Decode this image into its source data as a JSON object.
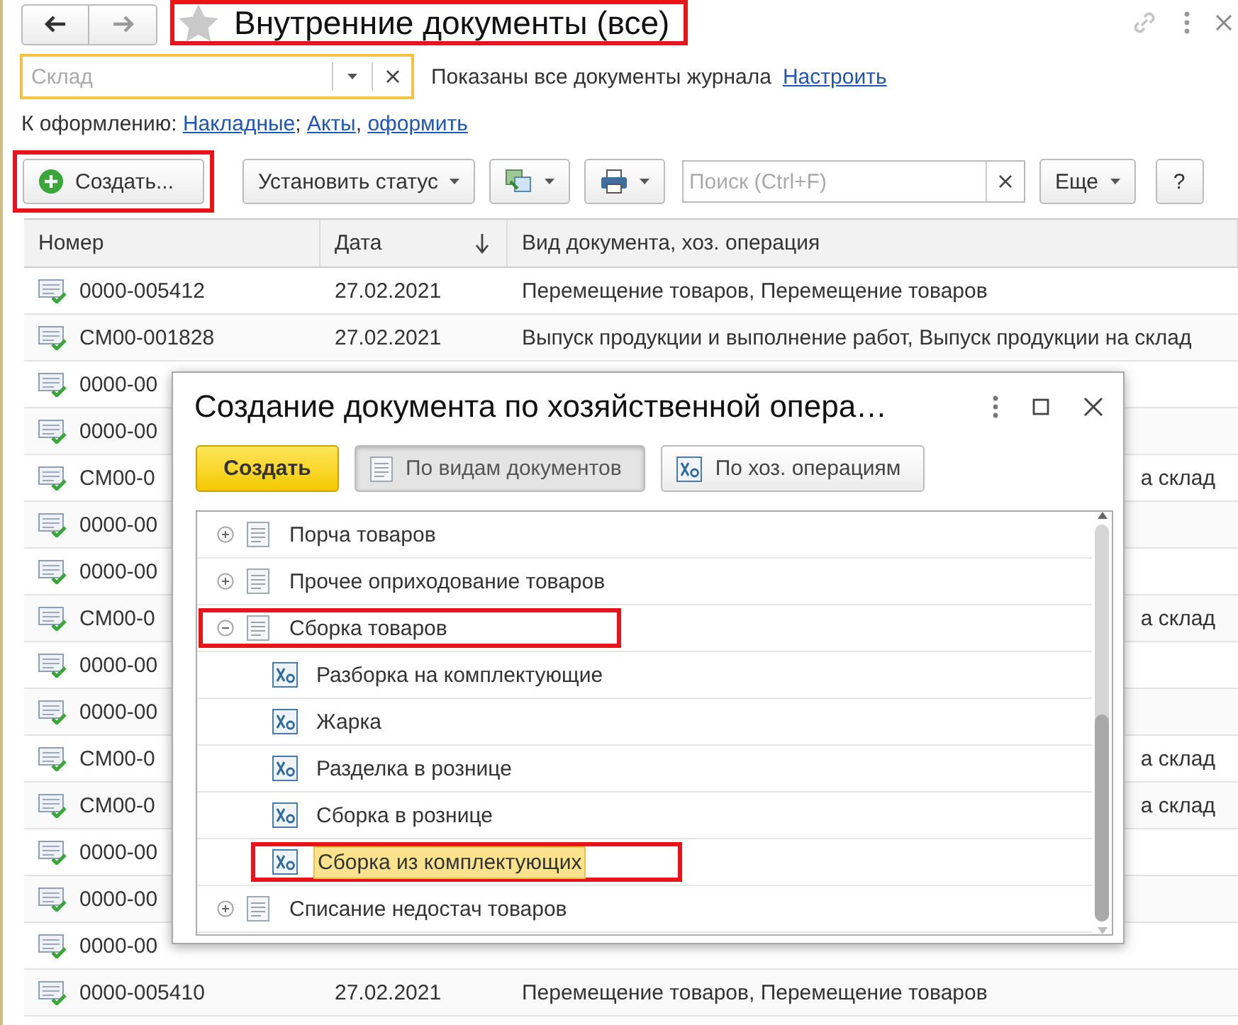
{
  "title": {
    "text": "Внутренние документы (все)",
    "highlighted": true
  },
  "filter": {
    "placeholder": "Склад",
    "status": "Показаны все документы журнала",
    "link": "Настроить"
  },
  "shortcuts": {
    "label": "К оформлению:",
    "links": [
      {
        "text": "Накладные",
        "separator": ";"
      },
      {
        "text": "Акты",
        "separator": ","
      },
      {
        "text": "оформить"
      }
    ]
  },
  "toolbar": {
    "create": {
      "label": "Создать...",
      "highlighted": true
    },
    "status_button": "Установить статус",
    "search": {
      "placeholder": "Поиск (Ctrl+F)"
    },
    "more": "Еще",
    "help": "?"
  },
  "table": {
    "columns": [
      {
        "label": "Номер",
        "sorted": false
      },
      {
        "label": "Дата",
        "sorted": true
      },
      {
        "label": "Вид документа, хоз. операция",
        "sorted": false
      }
    ],
    "rows": [
      {
        "number": "0000-005412",
        "date": "27.02.2021",
        "operation": "Перемещение товаров, Перемещение товаров"
      },
      {
        "number": "CM00-001828",
        "date": "27.02.2021",
        "operation": "Выпуск продукции и выполнение работ, Выпуск продукции на склад"
      },
      {
        "number": "0000-00"
      },
      {
        "number": "0000-00"
      },
      {
        "number": "CM00-0",
        "operation_tail": "а склад"
      },
      {
        "number": "0000-00"
      },
      {
        "number": "0000-00"
      },
      {
        "number": "CM00-0",
        "operation_tail": "а склад"
      },
      {
        "number": "0000-00"
      },
      {
        "number": "0000-00"
      },
      {
        "number": "CM00-0",
        "operation_tail": "а склад"
      },
      {
        "number": "CM00-0",
        "operation_tail": "а склад"
      },
      {
        "number": "0000-00"
      },
      {
        "number": "0000-00"
      },
      {
        "number": "0000-00"
      },
      {
        "number": "0000-005410",
        "date": "27.02.2021",
        "operation": "Перемещение товаров, Перемещение товаров"
      }
    ]
  },
  "dialog": {
    "title": "Создание документа по хозяйственной опера…",
    "create": "Создать",
    "views": [
      {
        "label": "По видам документов",
        "selected": true,
        "kind": "document"
      },
      {
        "label": "По хоз. операциям",
        "selected": false,
        "kind": "operation"
      }
    ],
    "tree": [
      {
        "label": "Порча товаров",
        "kind": "document",
        "expanded": false,
        "selected": false,
        "highlighted": false
      },
      {
        "label": "Прочее оприходование товаров",
        "kind": "document",
        "expanded": false,
        "selected": false,
        "highlighted": false
      },
      {
        "label": "Сборка товаров",
        "kind": "document",
        "expanded": true,
        "selected": false,
        "highlighted": true,
        "children": [
          {
            "label": "Разборка на комплектующие",
            "kind": "operation",
            "selected": false,
            "highlighted": false
          },
          {
            "label": "Жарка",
            "kind": "operation",
            "selected": false,
            "highlighted": false
          },
          {
            "label": "Разделка в рознице",
            "kind": "operation",
            "selected": false,
            "highlighted": false
          },
          {
            "label": "Сборка в рознице",
            "kind": "operation",
            "selected": false,
            "highlighted": false
          },
          {
            "label": "Сборка из комплектующих",
            "kind": "operation",
            "selected": true,
            "highlighted": true
          }
        ]
      },
      {
        "label": "Списание недостач товаров",
        "kind": "document",
        "expanded": false,
        "selected": false,
        "highlighted": false
      }
    ]
  }
}
